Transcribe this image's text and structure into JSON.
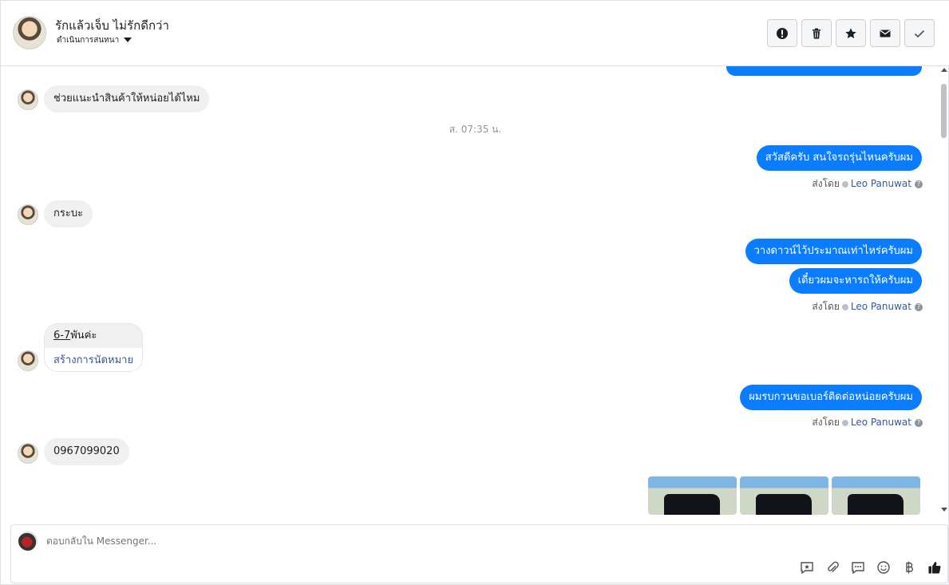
{
  "header": {
    "name": "รักแล้วเจ็บ ไม่รักดีกว่า",
    "status": "ดำเนินการสนทนา"
  },
  "messages": {
    "m1": "ช่วยแนะนำสินค้าให้หน่อยได้ไหม",
    "time1": "ส. 07:35 น.",
    "m2": "สวัสดีครับ สนใจรถรุ่นไหนครับผม",
    "m3": "กระบะ",
    "m4": "วางดาวน์ไว้ประมาณเท่าไหร่ครับผม",
    "m5": "เดี๋ยวผมจะหารถให้ครับผม",
    "m6_link": "6-7",
    "m6_rest": "พันค่ะ",
    "m6_action": "สร้างการนัดหมาย",
    "m7": "ผมรบกวนขอเบอร์ติดต่อหน่อยครับผม",
    "m8": "0967099020"
  },
  "sent_by": {
    "prefix": "ส่งโดย",
    "name": "Leo Panuwat",
    "help": "?"
  },
  "composer": {
    "placeholder": "ตอบกลับใน Messenger..."
  },
  "colors": {
    "outgoing": "#0a7cff",
    "incoming": "#f1f0f0",
    "link": "#385898"
  }
}
